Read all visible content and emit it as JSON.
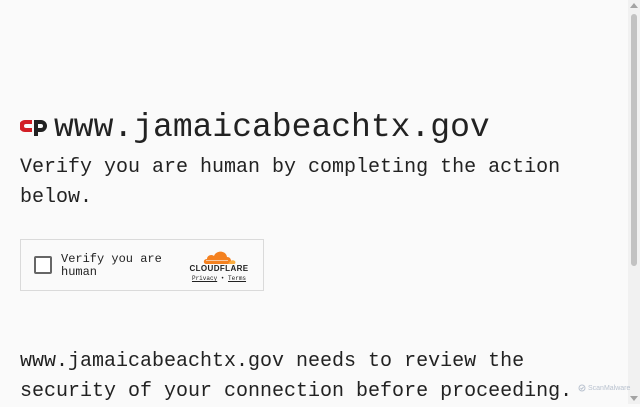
{
  "site": {
    "domain": "www.jamaicabeachtx.gov",
    "logo_icon": "cloudflare-challenge-logo-icon"
  },
  "challenge": {
    "prompt": "Verify you are human by completing the action below.",
    "widget": {
      "checkbox_label": "Verify you are human",
      "brand": "CLOUDFLARE",
      "privacy_link": "Privacy",
      "separator": "•",
      "terms_link": "Terms"
    },
    "review_message": "www.jamaicabeachtx.gov needs to review the security of your connection before proceeding."
  },
  "watermark": {
    "text": "ScanMalware"
  },
  "colors": {
    "accent_red": "#d21f26",
    "cloud_orange": "#f48120",
    "cloud_light_orange": "#faad3f",
    "background": "#fafafa",
    "text": "#222222"
  }
}
